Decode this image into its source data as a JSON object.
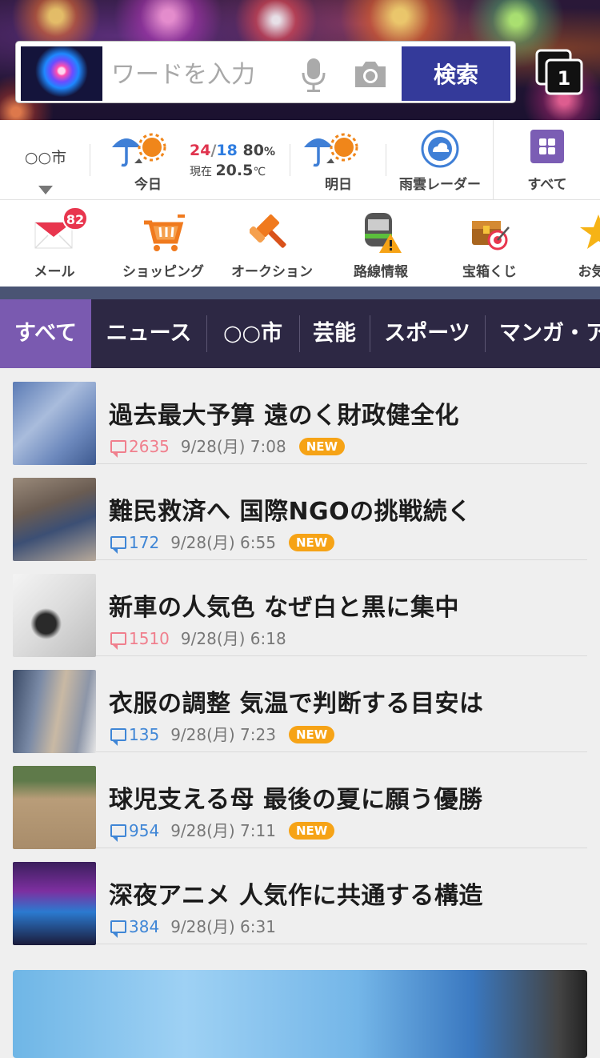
{
  "search": {
    "placeholder": "ワードを入力",
    "button_label": "検索",
    "tab_count": "1"
  },
  "weather": {
    "city": "○○市",
    "today": {
      "label": "今日",
      "high": "24",
      "sep": "/",
      "low": "18",
      "precip": "80",
      "precip_unit": "%",
      "now_label": "現在",
      "now_temp": "20.5",
      "now_unit": "℃"
    },
    "tomorrow": {
      "label": "明日"
    },
    "radar_label": "雨雲レーダー",
    "all_label": "すべて"
  },
  "services": [
    {
      "label": "メール",
      "badge": "82",
      "icon": "mail-icon"
    },
    {
      "label": "ショッピング",
      "icon": "cart-icon"
    },
    {
      "label": "オークション",
      "icon": "gavel-icon"
    },
    {
      "label": "路線情報",
      "icon": "train-icon"
    },
    {
      "label": "宝箱くじ",
      "icon": "treasure-icon"
    },
    {
      "label": "お気に",
      "icon": "star-icon"
    }
  ],
  "categories": [
    "すべて",
    "ニュース",
    "○○市",
    "芸能",
    "スポーツ",
    "マンガ・ア"
  ],
  "news": [
    {
      "title": "過去最大予算 遠のく財政健全化",
      "comments": "2635",
      "time": "9/28(月) 7:08",
      "new": "NEW"
    },
    {
      "title": "難民救済へ 国際NGOの挑戦続く",
      "comments": "172",
      "time": "9/28(月) 6:55",
      "new": "NEW"
    },
    {
      "title": "新車の人気色 なぜ白と黒に集中",
      "comments": "1510",
      "time": "9/28(月) 6:18"
    },
    {
      "title": "衣服の調整 気温で判断する目安は",
      "comments": "135",
      "time": "9/28(月) 7:23",
      "new": "NEW"
    },
    {
      "title": "球児支える母 最後の夏に願う優勝",
      "comments": "954",
      "time": "9/28(月) 7:11",
      "new": "NEW"
    },
    {
      "title": "深夜アニメ 人気作に共通する構造",
      "comments": "384",
      "time": "9/28(月) 6:31"
    }
  ],
  "colors": {
    "brand": "#343a9a",
    "accent": "#7a5ab0",
    "hot_comment": "#f07f8d",
    "comment": "#3f86d6",
    "new_badge": "#f6a316"
  }
}
